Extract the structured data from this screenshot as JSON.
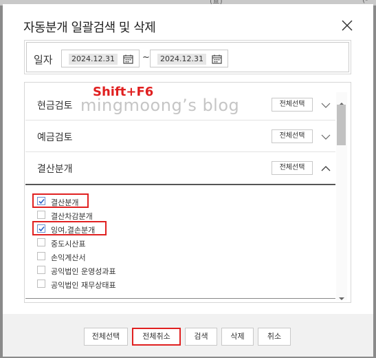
{
  "background": {
    "fragment_a": "(표)",
    "fragment_b": "(-"
  },
  "dialog": {
    "title": "자동분개 일괄검색 및 삭제",
    "close_icon": "close-icon"
  },
  "date": {
    "label": "일자",
    "from": "2024.12.31",
    "separator": "~",
    "to": "2024.12.31",
    "calendar_icon": "calendar-icon"
  },
  "sections": [
    {
      "name": "현금검토",
      "select_label": "전체선택",
      "expanded": false,
      "chevron_icon": "chevron-down-icon"
    },
    {
      "name": "예금검토",
      "select_label": "전체선택",
      "expanded": false,
      "chevron_icon": "chevron-down-icon"
    },
    {
      "name": "결산분개",
      "select_label": "전체선택",
      "expanded": true,
      "chevron_icon": "chevron-up-icon"
    }
  ],
  "items": [
    {
      "label": "결산분개",
      "checked": true,
      "highlighted": true
    },
    {
      "label": "결산차감분개",
      "checked": false,
      "highlighted": false
    },
    {
      "label": "잉여,결손분개",
      "checked": true,
      "highlighted": true
    },
    {
      "label": "중도시산표",
      "checked": false,
      "highlighted": false
    },
    {
      "label": "손익계산서",
      "checked": false,
      "highlighted": false
    },
    {
      "label": "공익법인 운영성과표",
      "checked": false,
      "highlighted": false
    },
    {
      "label": "공익법인 재무상태표",
      "checked": false,
      "highlighted": false
    }
  ],
  "annotation": {
    "shortcut": "Shift+F6",
    "watermark": "mingmoong’s blog"
  },
  "footer": {
    "select_all": "전체선택",
    "deselect_all": "전체취소",
    "search": "검색",
    "delete": "삭제",
    "cancel": "취소"
  },
  "colors": {
    "highlight": "#e02020",
    "check": "#2b62c9"
  }
}
